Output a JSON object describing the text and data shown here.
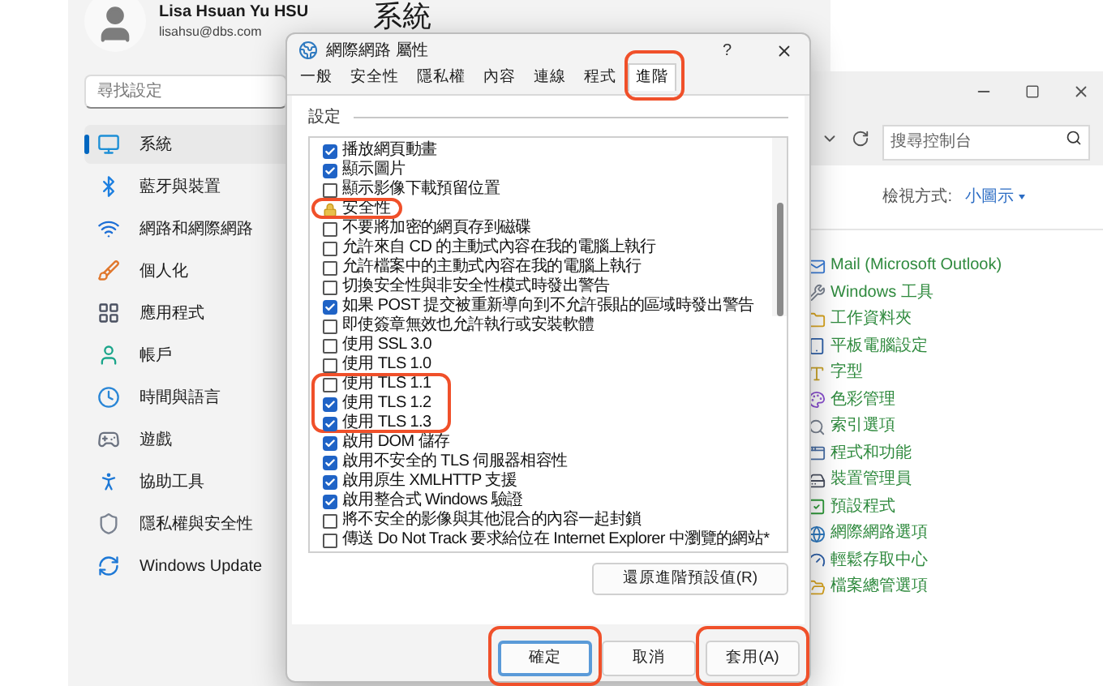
{
  "settings": {
    "user": {
      "name": "Lisa Hsuan Yu HSU",
      "email": "lisahsu@dbs.com"
    },
    "search": {
      "placeholder": "尋找設定"
    },
    "heading": "系統",
    "nav": [
      {
        "label": "系統",
        "selected": true
      },
      {
        "label": "藍牙與裝置",
        "selected": false
      },
      {
        "label": "網路和網際網路",
        "selected": false
      },
      {
        "label": "個人化",
        "selected": false
      },
      {
        "label": "應用程式",
        "selected": false
      },
      {
        "label": "帳戶",
        "selected": false
      },
      {
        "label": "時間與語言",
        "selected": false
      },
      {
        "label": "遊戲",
        "selected": false
      },
      {
        "label": "協助工具",
        "selected": false
      },
      {
        "label": "隱私權與安全性",
        "selected": false
      },
      {
        "label": "Windows Update",
        "selected": false
      }
    ]
  },
  "control_panel": {
    "search": {
      "placeholder": "搜尋控制台"
    },
    "view_by": {
      "label": "檢視方式:",
      "value": "小圖示"
    },
    "items": [
      {
        "label": "Mail (Microsoft Outlook)"
      },
      {
        "label": "Windows 工具"
      },
      {
        "label": "工作資料夾"
      },
      {
        "label": "平板電腦設定"
      },
      {
        "label": "字型"
      },
      {
        "label": "色彩管理"
      },
      {
        "label": "索引選項"
      },
      {
        "label": "程式和功能"
      },
      {
        "label": "裝置管理員"
      },
      {
        "label": "預設程式"
      },
      {
        "label": "網際網路選項"
      },
      {
        "label": "輕鬆存取中心"
      },
      {
        "label": "檔案總管選項"
      }
    ]
  },
  "dialog": {
    "title": "網際網路 屬性",
    "help": "?",
    "tabs": [
      {
        "label": "一般",
        "selected": false,
        "highlighted": false
      },
      {
        "label": "安全性",
        "selected": false,
        "highlighted": false
      },
      {
        "label": "隱私權",
        "selected": false,
        "highlighted": false
      },
      {
        "label": "內容",
        "selected": false,
        "highlighted": false
      },
      {
        "label": "連線",
        "selected": false,
        "highlighted": false
      },
      {
        "label": "程式",
        "selected": false,
        "highlighted": false
      },
      {
        "label": "進階",
        "selected": true,
        "highlighted": true
      }
    ],
    "section_label": "設定",
    "options": [
      {
        "kind": "checkbox",
        "label": "播放網頁動畫",
        "checked": true,
        "highlighted": false
      },
      {
        "kind": "checkbox",
        "label": "顯示圖片",
        "checked": true,
        "highlighted": false
      },
      {
        "kind": "checkbox",
        "label": "顯示影像下載預留位置",
        "checked": false,
        "highlighted": false
      },
      {
        "kind": "group",
        "label": "安全性",
        "highlighted": true
      },
      {
        "kind": "checkbox",
        "label": "不要將加密的網頁存到磁碟",
        "checked": false,
        "highlighted": false
      },
      {
        "kind": "checkbox",
        "label": "允許來自 CD 的主動式內容在我的電腦上執行",
        "checked": false,
        "highlighted": false
      },
      {
        "kind": "checkbox",
        "label": "允許檔案中的主動式內容在我的電腦上執行",
        "checked": false,
        "highlighted": false
      },
      {
        "kind": "checkbox",
        "label": "切換安全性與非安全性模式時發出警告",
        "checked": false,
        "highlighted": false
      },
      {
        "kind": "checkbox",
        "label": "如果 POST 提交被重新導向到不允許張貼的區域時發出警告",
        "checked": true,
        "highlighted": false
      },
      {
        "kind": "checkbox",
        "label": "即使簽章無效也允許執行或安裝軟體",
        "checked": false,
        "highlighted": false
      },
      {
        "kind": "checkbox",
        "label": "使用 SSL 3.0",
        "checked": false,
        "highlighted": false
      },
      {
        "kind": "checkbox",
        "label": "使用 TLS 1.0",
        "checked": false,
        "highlighted": false
      },
      {
        "kind": "checkbox",
        "label": "使用 TLS 1.1",
        "checked": false,
        "highlighted": true
      },
      {
        "kind": "checkbox",
        "label": "使用 TLS 1.2",
        "checked": true,
        "highlighted": true
      },
      {
        "kind": "checkbox",
        "label": "使用 TLS 1.3",
        "checked": true,
        "highlighted": true
      },
      {
        "kind": "checkbox",
        "label": "啟用 DOM 儲存",
        "checked": true,
        "highlighted": false
      },
      {
        "kind": "checkbox",
        "label": "啟用不安全的 TLS 伺服器相容性",
        "checked": true,
        "highlighted": false
      },
      {
        "kind": "checkbox",
        "label": "啟用原生 XMLHTTP 支援",
        "checked": true,
        "highlighted": false
      },
      {
        "kind": "checkbox",
        "label": "啟用整合式 Windows 驗證",
        "checked": true,
        "highlighted": false
      },
      {
        "kind": "checkbox",
        "label": "將不安全的影像與其他混合的內容一起封鎖",
        "checked": false,
        "highlighted": false
      },
      {
        "kind": "checkbox",
        "label": "傳送 Do Not Track 要求給位在 Internet Explorer 中瀏覽的網站*",
        "checked": false,
        "highlighted": false
      }
    ],
    "reset_button": "還原進階預設值(R)",
    "buttons": [
      {
        "label": "確定",
        "default": true,
        "highlighted": true
      },
      {
        "label": "取消",
        "default": false,
        "highlighted": false
      },
      {
        "label": "套用(A)",
        "default": false,
        "highlighted": true
      }
    ]
  }
}
